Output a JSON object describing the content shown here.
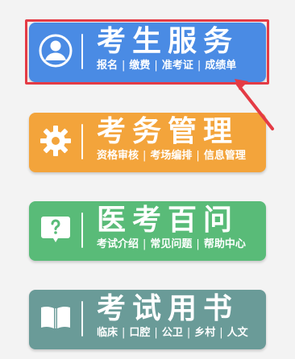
{
  "cards": [
    {
      "title": "考生服务",
      "subtitle_items": [
        "报名",
        "缴费",
        "准考证",
        "成绩单"
      ],
      "icon": "user-icon",
      "color": "#4a8be4"
    },
    {
      "title": "考务管理",
      "subtitle_items": [
        "资格审核",
        "考场编排",
        "信息管理"
      ],
      "icon": "gear-icon",
      "color": "#f3a43b"
    },
    {
      "title": "医考百问",
      "subtitle_items": [
        "考试介绍",
        "常见问题",
        "帮助中心"
      ],
      "icon": "question-bubble-icon",
      "color": "#59bb78"
    },
    {
      "title": "考试用书",
      "subtitle_items": [
        "临床",
        "口腔",
        "公卫",
        "乡村",
        "人文"
      ],
      "icon": "book-icon",
      "color": "#6a9b98"
    }
  ],
  "annotation": {
    "highlight_color": "#e43b45"
  }
}
